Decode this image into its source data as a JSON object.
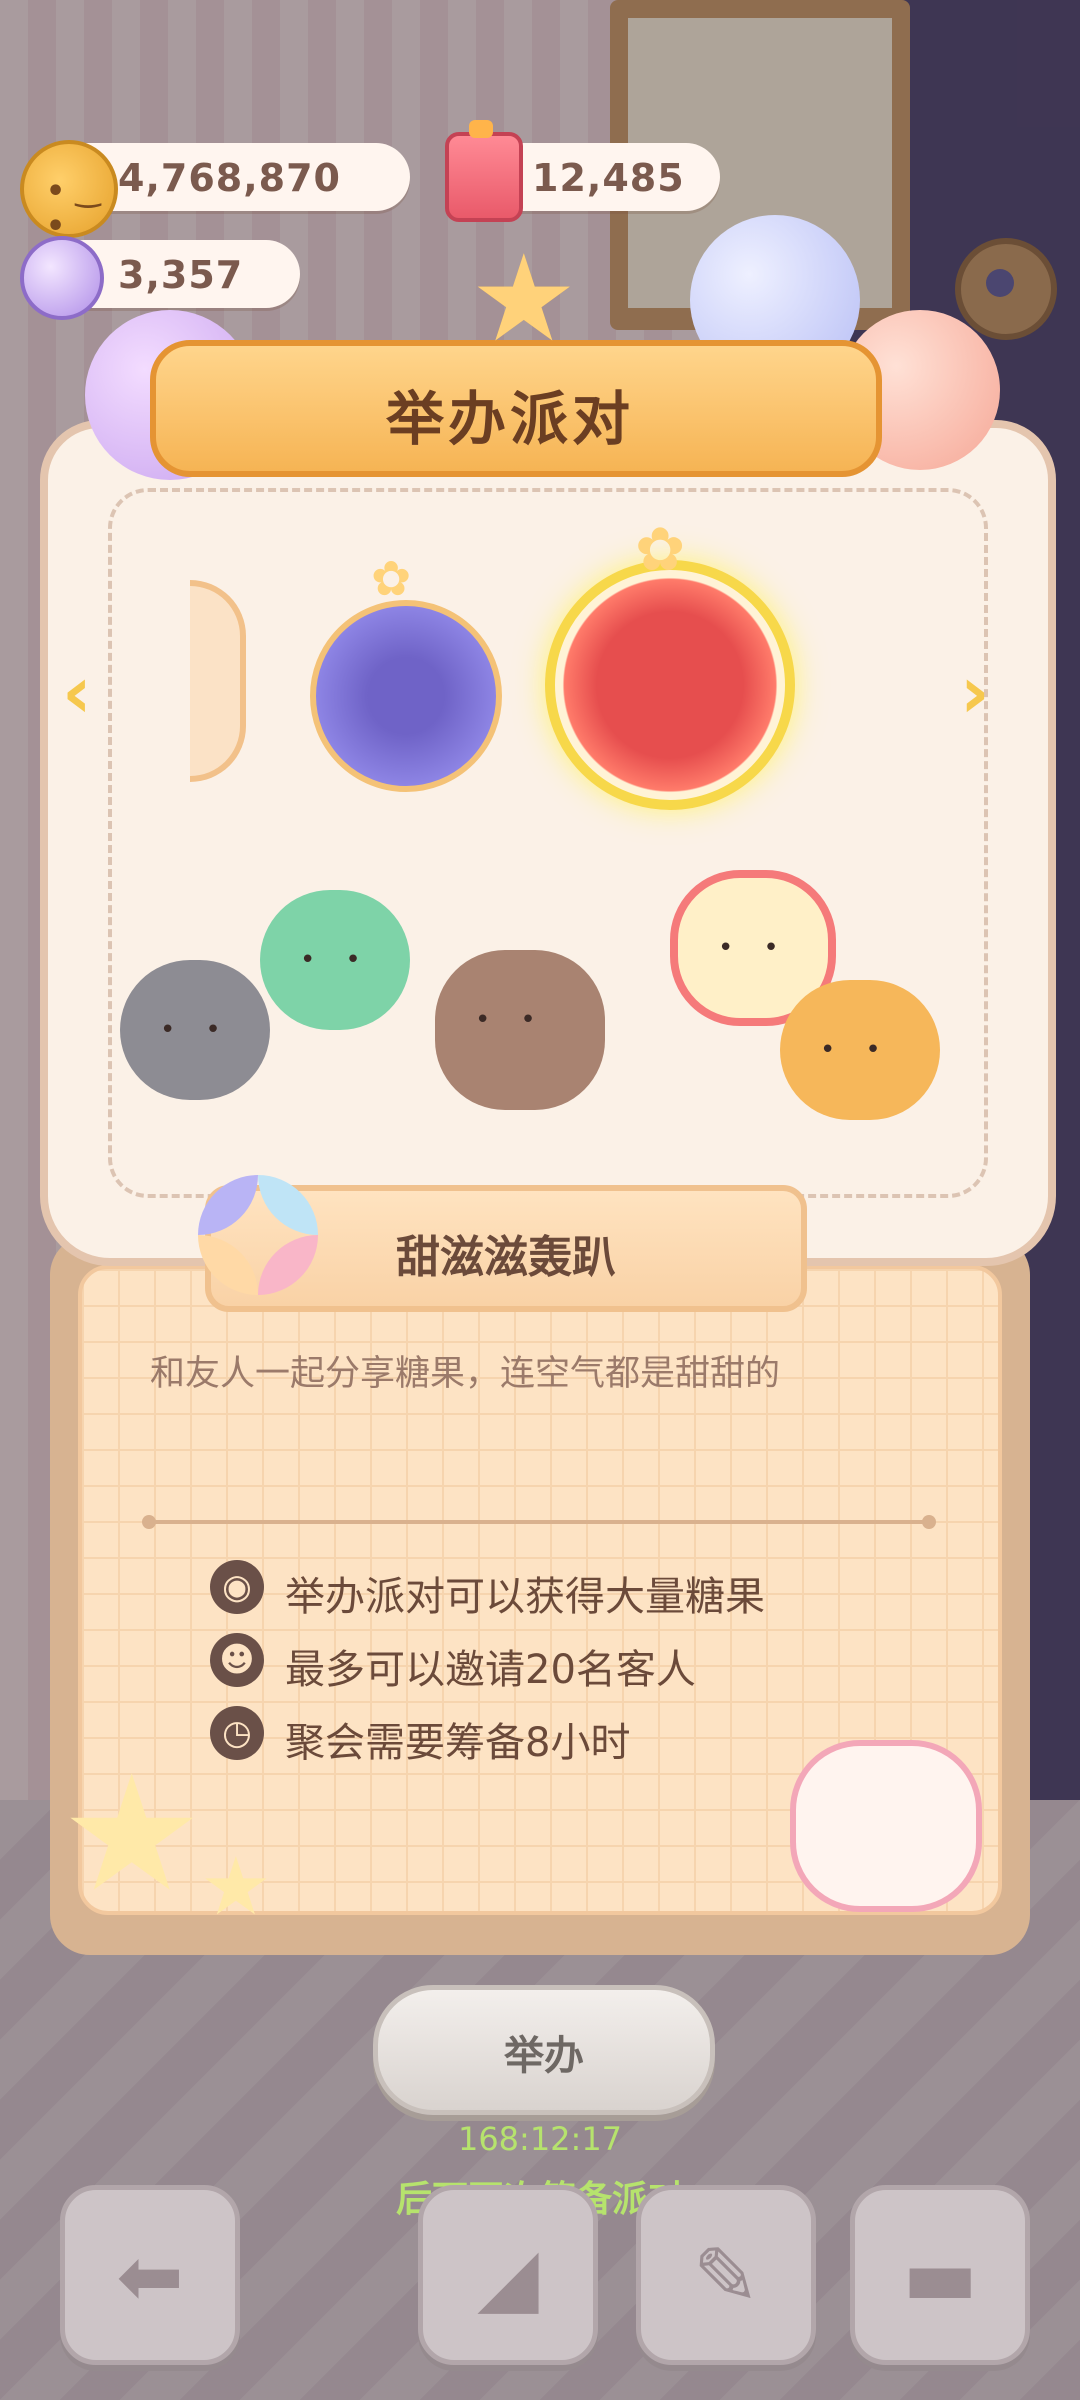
{
  "resources": {
    "coins": "4,768,870",
    "candy": "12,485",
    "gems": "3,357"
  },
  "dialog": {
    "title": "举办派对",
    "party_name": "甜滋滋轰趴",
    "description": "和友人一起分享糖果，连空气都是甜甜的",
    "features": [
      {
        "icon": "candy-icon",
        "text": "举办派对可以获得大量糖果"
      },
      {
        "icon": "guest-icon",
        "text": "最多可以邀请20名客人"
      },
      {
        "icon": "alarm-clock-icon",
        "text": "聚会需要筹备8小时"
      }
    ],
    "hold_button": "举办",
    "cooldown_timer": "168:12:17",
    "cooldown_text": "后可再次筹备派对"
  },
  "nav_icons": {
    "prev": "chevron-left-icon",
    "next": "chevron-right-icon"
  },
  "bottom_bar": [
    {
      "icon": "back-arrow-icon"
    },
    {
      "icon": "party-popper-icon"
    },
    {
      "icon": "decorate-icon"
    },
    {
      "icon": "sofa-icon"
    }
  ],
  "colors": {
    "accent": "#f6b454",
    "timer": "#b6e36d",
    "text_brown": "#6b4a3a"
  }
}
